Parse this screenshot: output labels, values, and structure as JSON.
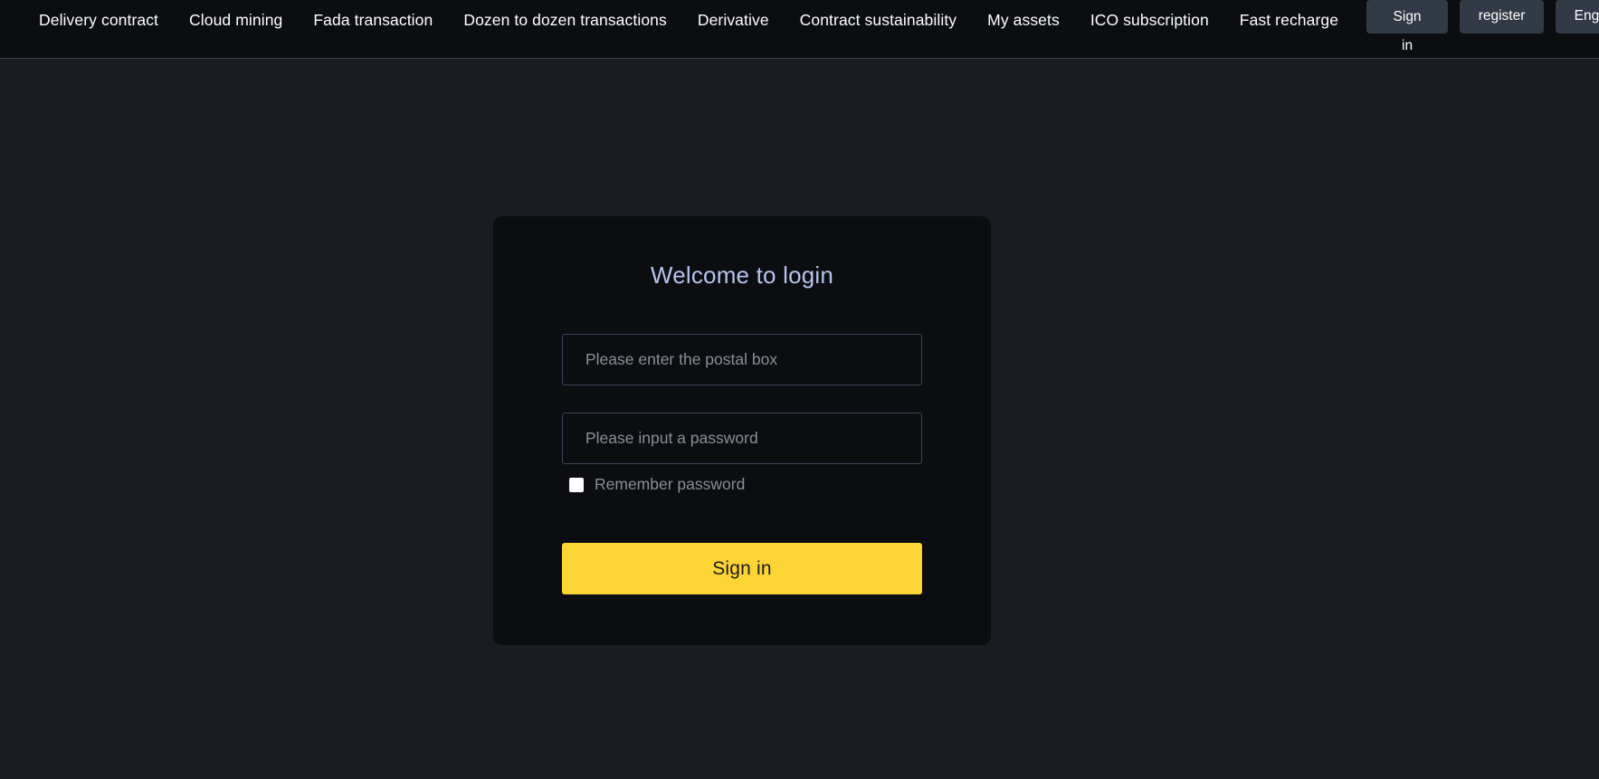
{
  "navbar": {
    "links": [
      {
        "label": "Delivery contract"
      },
      {
        "label": "Cloud mining"
      },
      {
        "label": "Fada transaction"
      },
      {
        "label": "Dozen to dozen transactions"
      },
      {
        "label": "Derivative"
      },
      {
        "label": "Contract sustainability"
      },
      {
        "label": "My assets"
      },
      {
        "label": "ICO subscription"
      },
      {
        "label": "Fast recharge"
      }
    ],
    "actions": {
      "sign_in_label": "Sign in",
      "register_label": "register",
      "language_label": "English"
    }
  },
  "login": {
    "title": "Welcome to login",
    "email_placeholder": "Please enter the postal box",
    "email_value": "",
    "password_placeholder": "Please input a password",
    "password_value": "",
    "remember_label": "Remember password",
    "remember_checked": false,
    "submit_label": "Sign in"
  },
  "colors": {
    "page_background": "#1b1c21",
    "nav_background": "#0b0d11",
    "nav_border": "#39445a",
    "card_background": "#0b0d11",
    "title_accent": "#b6c3ec",
    "field_border": "#3b4455",
    "placeholder": "#8a8f99",
    "primary_button": "#fcd535",
    "primary_button_text": "#1b1c21",
    "nav_button": "#323a47"
  }
}
